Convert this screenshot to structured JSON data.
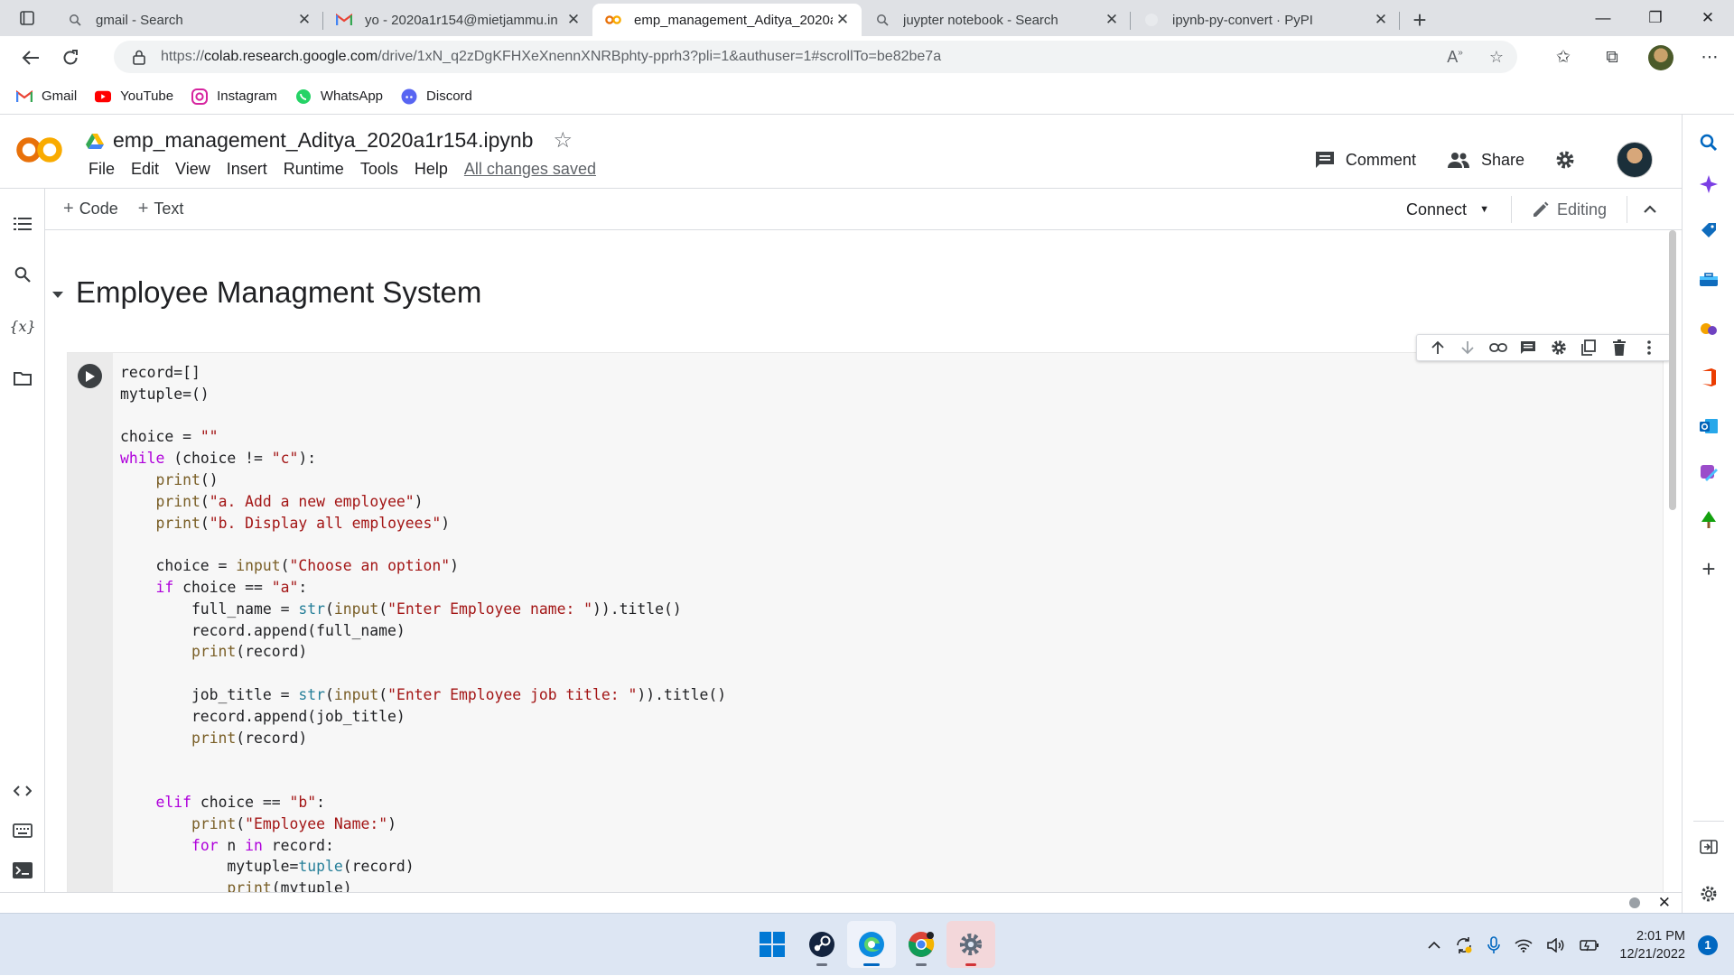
{
  "browser": {
    "tabs": [
      {
        "title": "gmail - Search",
        "favicon": "search-icon",
        "active": false
      },
      {
        "title": "yo - 2020a1r154@mietjammu.in",
        "favicon": "gmail-icon",
        "active": false
      },
      {
        "title": "emp_management_Aditya_2020a",
        "favicon": "colab-icon",
        "active": true
      },
      {
        "title": "juypter notebook - Search",
        "favicon": "search-icon",
        "active": false
      },
      {
        "title": "ipynb-py-convert · PyPI",
        "favicon": "pypi-icon",
        "active": false
      }
    ],
    "new_tab": "+",
    "window_controls": {
      "minimize": "—",
      "restore": "❐",
      "close": "✕"
    },
    "url_scheme": "https://",
    "url_host": "colab.research.google.com",
    "url_rest": "/drive/1xN_q2zDgKFHXeXnennXNRBphty-pprh3?pli=1&authuser=1#scrollTo=be82be7a",
    "bookmarks": [
      {
        "label": "Gmail",
        "icon": "gmail-icon"
      },
      {
        "label": "YouTube",
        "icon": "youtube-icon"
      },
      {
        "label": "Instagram",
        "icon": "instagram-icon"
      },
      {
        "label": "WhatsApp",
        "icon": "whatsapp-icon"
      },
      {
        "label": "Discord",
        "icon": "discord-icon"
      }
    ]
  },
  "colab": {
    "logo_text": "CO",
    "notebook_title": "emp_management_Aditya_2020a1r154.ipynb",
    "menu": [
      "File",
      "Edit",
      "View",
      "Insert",
      "Runtime",
      "Tools",
      "Help"
    ],
    "save_status": "All changes saved",
    "comment_label": "Comment",
    "share_label": "Share",
    "add_code_label": "Code",
    "add_text_label": "Text",
    "connect_label": "Connect",
    "editing_label": "Editing",
    "section_heading": "Employee Managment System"
  },
  "code_lines": [
    [
      [
        "",
        "record=[]"
      ]
    ],
    [
      [
        "",
        "mytuple=()"
      ]
    ],
    [],
    [
      [
        "",
        "choice = "
      ],
      [
        "st",
        "\"\""
      ]
    ],
    [
      [
        "kw",
        "while"
      ],
      [
        "",
        " (choice != "
      ],
      [
        "st",
        "\"c\""
      ],
      [
        "",
        "):"
      ]
    ],
    [
      [
        "",
        "    "
      ],
      [
        "bi",
        "print"
      ],
      [
        "",
        "()"
      ]
    ],
    [
      [
        "",
        "    "
      ],
      [
        "bi",
        "print"
      ],
      [
        "",
        "("
      ],
      [
        "st",
        "\"a. Add a new employee\""
      ],
      [
        "",
        ")"
      ]
    ],
    [
      [
        "",
        "    "
      ],
      [
        "bi",
        "print"
      ],
      [
        "",
        "("
      ],
      [
        "st",
        "\"b. Display all employees\""
      ],
      [
        "",
        ")"
      ]
    ],
    [],
    [
      [
        "",
        "    choice = "
      ],
      [
        "bi",
        "input"
      ],
      [
        "",
        "("
      ],
      [
        "st",
        "\"Choose an option\""
      ],
      [
        "",
        ")"
      ]
    ],
    [
      [
        "",
        "    "
      ],
      [
        "kw",
        "if"
      ],
      [
        "",
        " choice == "
      ],
      [
        "st",
        "\"a\""
      ],
      [
        "",
        ":"
      ]
    ],
    [
      [
        "",
        "        full_name = "
      ],
      [
        "fn",
        "str"
      ],
      [
        "",
        "("
      ],
      [
        "bi",
        "input"
      ],
      [
        "",
        "("
      ],
      [
        "st",
        "\"Enter Employee name: \""
      ],
      [
        "",
        ")).title()"
      ]
    ],
    [
      [
        "",
        "        record.append(full_name)"
      ]
    ],
    [
      [
        "",
        "        "
      ],
      [
        "bi",
        "print"
      ],
      [
        "",
        "(record)"
      ]
    ],
    [],
    [
      [
        "",
        "        job_title = "
      ],
      [
        "fn",
        "str"
      ],
      [
        "",
        "("
      ],
      [
        "bi",
        "input"
      ],
      [
        "",
        "("
      ],
      [
        "st",
        "\"Enter Employee job title: \""
      ],
      [
        "",
        ")).title()"
      ]
    ],
    [
      [
        "",
        "        record.append(job_title)"
      ]
    ],
    [
      [
        "",
        "        "
      ],
      [
        "bi",
        "print"
      ],
      [
        "",
        "(record)"
      ]
    ],
    [],
    [],
    [
      [
        "",
        "    "
      ],
      [
        "kw",
        "elif"
      ],
      [
        "",
        " choice == "
      ],
      [
        "st",
        "\"b\""
      ],
      [
        "",
        ":"
      ]
    ],
    [
      [
        "",
        "        "
      ],
      [
        "bi",
        "print"
      ],
      [
        "",
        "("
      ],
      [
        "st",
        "\"Employee Name:\""
      ],
      [
        "",
        ")"
      ]
    ],
    [
      [
        "",
        "        "
      ],
      [
        "kw",
        "for"
      ],
      [
        "",
        " n "
      ],
      [
        "kw",
        "in"
      ],
      [
        "",
        " record:"
      ]
    ],
    [
      [
        "",
        "            mytuple="
      ],
      [
        "fn",
        "tuple"
      ],
      [
        "",
        "(record)"
      ]
    ],
    [
      [
        "",
        "            "
      ],
      [
        "bi",
        "print"
      ],
      [
        "",
        "(mytuple)"
      ]
    ]
  ],
  "taskbar": {
    "apps": [
      "windows-start-icon",
      "steam-icon",
      "edge-icon",
      "chrome-icon",
      "settings-icon"
    ],
    "time": "2:01 PM",
    "date": "12/21/2022",
    "notification_count": "1"
  },
  "colors": {
    "colab_orange": "#F9AB00",
    "colab_orange_dark": "#E8710A",
    "keyword": "#AF00DB",
    "builtin": "#795E26",
    "type": "#267F99",
    "string": "#A31515"
  }
}
